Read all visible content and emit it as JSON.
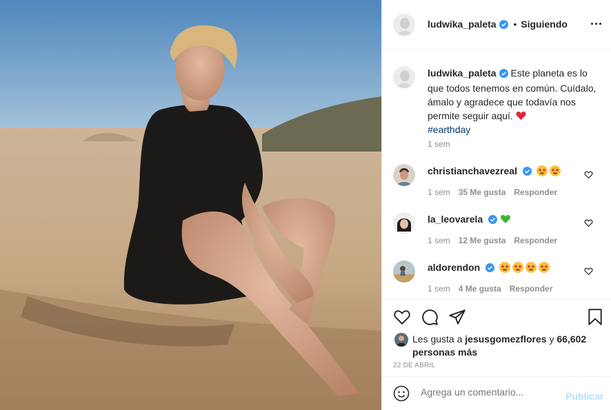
{
  "post": {
    "author": "ludwika_paleta",
    "follow_status": "Siguiendo",
    "follow_separator": "•",
    "caption": "Este planeta es lo que todos tenemos en común. Cuídalo, ámalo y agradece que todavía nos permite seguir aquí.",
    "caption_emoji": "red-heart",
    "hashtag": "#earthday",
    "caption_time": "1 sem"
  },
  "comments": [
    {
      "user": "christianchavezreal",
      "emojis": [
        "star-struck",
        "star-struck"
      ],
      "time": "1 sem",
      "likes": "35 Me gusta",
      "reply": "Responder"
    },
    {
      "user": "la_leovarela",
      "emojis": [
        "green-heart"
      ],
      "time": "1 sem",
      "likes": "12 Me gusta",
      "reply": "Responder"
    },
    {
      "user": "aldorendon",
      "emojis": [
        "star-struck",
        "star-struck",
        "star-struck",
        "star-struck"
      ],
      "time": "1 sem",
      "likes": "4 Me gusta",
      "reply": "Responder"
    }
  ],
  "actions": {
    "icons": [
      "heart-icon",
      "comment-icon",
      "share-icon",
      "bookmark-icon"
    ],
    "likes_prefix": "Les gusta a",
    "likes_user": "jesusgomezflores",
    "likes_conj": "y",
    "likes_count": "66,602 personas más",
    "date": "22 DE ABRIL"
  },
  "composer": {
    "placeholder": "Agrega un comentario...",
    "publish_label": "Publicar"
  },
  "colors": {
    "verified": "#3897f0",
    "link": "#00376b",
    "muted": "#8e8e8e",
    "publish_disabled": "#b2dffc"
  }
}
